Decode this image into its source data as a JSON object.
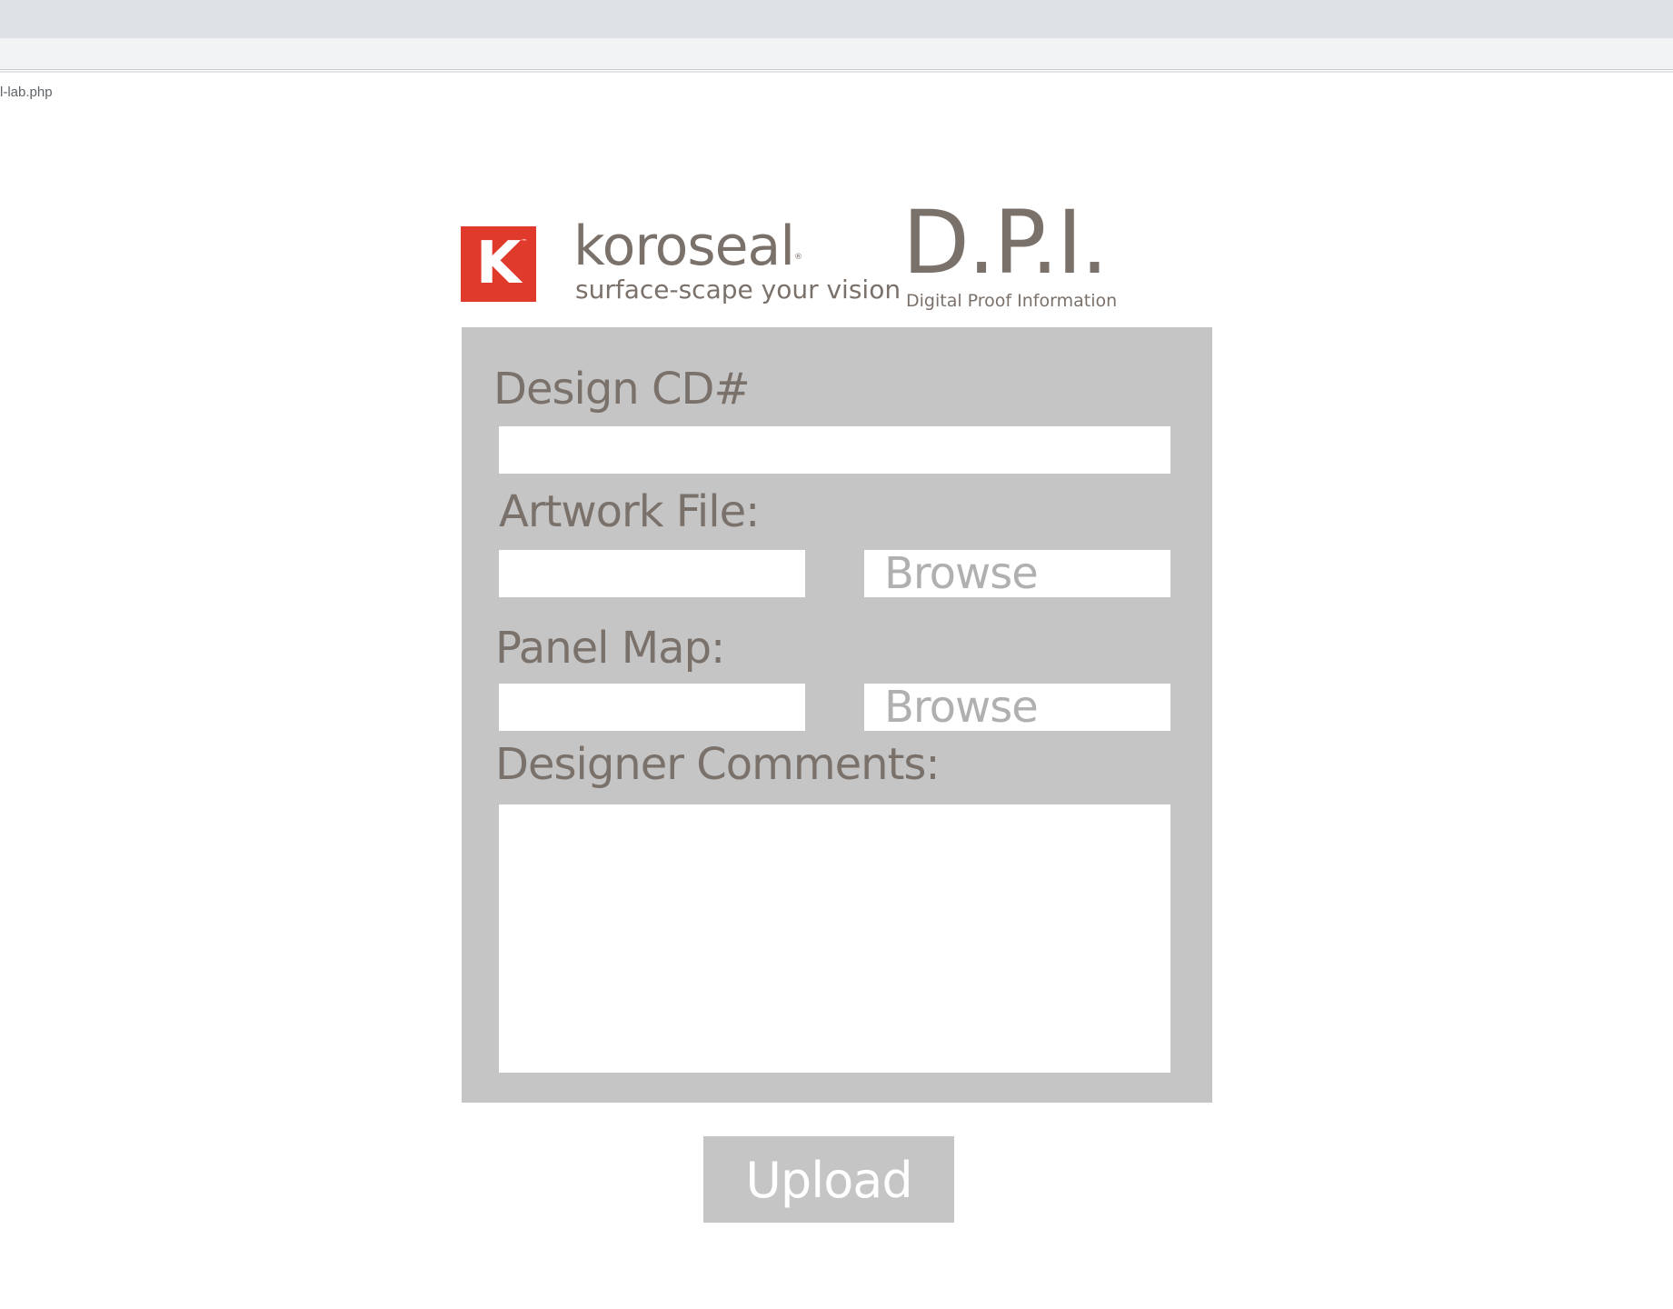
{
  "browser": {
    "url": "l-lab.php"
  },
  "header": {
    "logo_letter": "K",
    "logo_tm": "™",
    "brand_name": "koroseal",
    "brand_reg": "®",
    "brand_tagline": "surface-scape your vision",
    "dpi_title": "D.P.I.",
    "dpi_subtitle": "Digital Proof Information"
  },
  "form": {
    "design_cd_label": "Design CD#",
    "design_cd_value": "",
    "artwork_label": "Artwork File:",
    "artwork_value": "",
    "artwork_browse_label": "Browse",
    "panel_map_label": "Panel Map:",
    "panel_map_value": "",
    "panel_map_browse_label": "Browse",
    "comments_label": "Designer Comments:",
    "comments_value": ""
  },
  "actions": {
    "upload_label": "Upload"
  },
  "colors": {
    "brand_red": "#e03a2c",
    "text_taupe": "#7b716b",
    "panel_gray": "#c5c5c5",
    "browse_text": "#b0b0b0"
  }
}
